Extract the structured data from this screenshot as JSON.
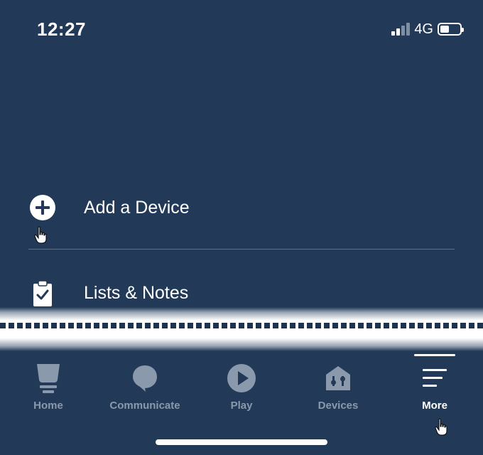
{
  "status": {
    "time": "12:27",
    "network": "4G"
  },
  "menu": {
    "items": [
      {
        "label": "Add a Device",
        "icon": "plus-circle-icon"
      },
      {
        "label": "Lists & Notes",
        "icon": "clipboard-check-icon"
      }
    ]
  },
  "tabs": [
    {
      "label": "Home",
      "icon": "home-lamp-icon"
    },
    {
      "label": "Communicate",
      "icon": "speech-bubble-icon"
    },
    {
      "label": "Play",
      "icon": "play-circle-icon"
    },
    {
      "label": "Devices",
      "icon": "devices-house-icon"
    },
    {
      "label": "More",
      "icon": "hamburger-menu-icon",
      "active": true
    }
  ],
  "colors": {
    "background": "#223a57",
    "inactive_tab": "#8a99ab",
    "active_tab": "#ffffff"
  }
}
